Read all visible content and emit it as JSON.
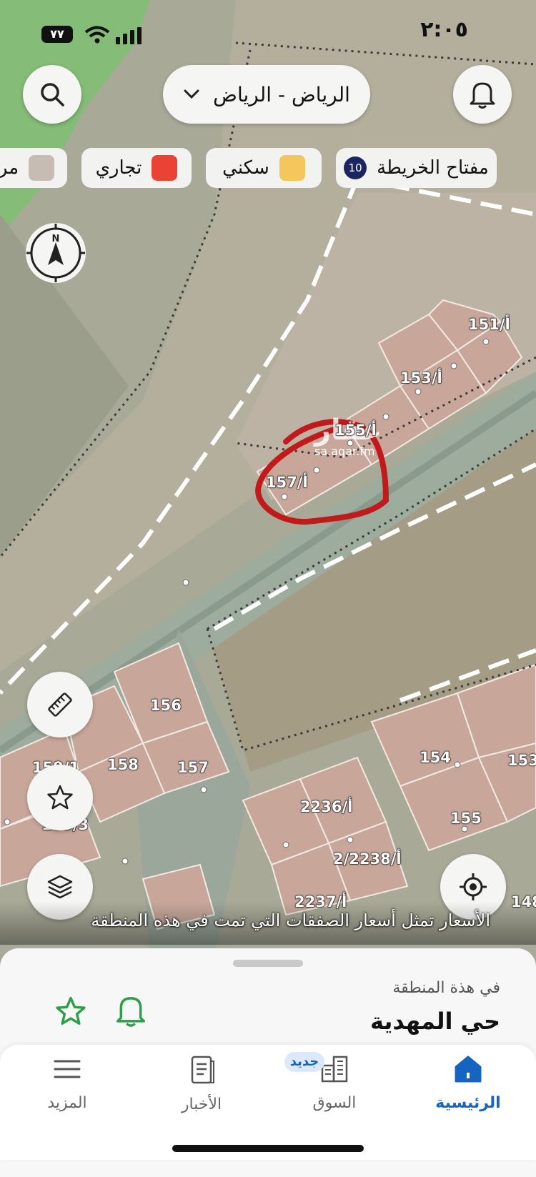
{
  "status_bar": {
    "time": "٢:٠٥",
    "battery": "٧٧"
  },
  "header": {
    "city": "الرياض - الرياض"
  },
  "legend": {
    "key_label": "مفتاح الخريطة",
    "key_count": "10",
    "items": [
      {
        "label": "سكني",
        "color": "#f5c65b"
      },
      {
        "label": "تجاري",
        "color": "#ea4335"
      },
      {
        "label": "مر",
        "color": "#c7bcb4"
      }
    ]
  },
  "map": {
    "lots": [
      "151/أ",
      "153/أ",
      "155/أ",
      "157/أ",
      "156",
      "158",
      "157",
      "159/1",
      "159/3",
      "154",
      "153",
      "155",
      "2236/أ",
      "2/أ/2238",
      "2237/أ",
      "148"
    ],
    "compass_letter": "N",
    "watermark_brand": "عقار",
    "watermark_url": "sa.aqar.fm",
    "notice": "الأسعار تمثل أسعار الصفقات التي تمت في هذه المنطقة"
  },
  "area": {
    "subtitle": "في هذة المنطقة",
    "title": "حي المهدية"
  },
  "nav": {
    "home": "الرئيسية",
    "market": "السوق",
    "market_badge": "جديد",
    "news": "الأخبار",
    "more": "المزيد"
  },
  "colors": {
    "accent": "#1565c0",
    "green": "#2e9e48",
    "parcel": "#c8a79a"
  }
}
